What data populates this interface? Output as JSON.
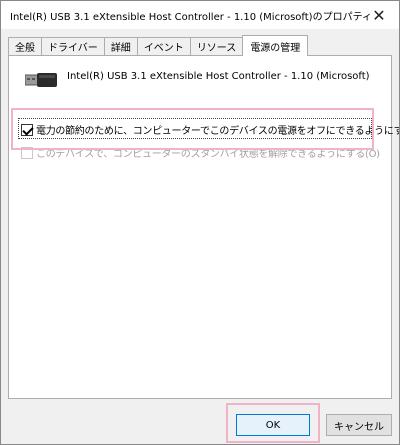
{
  "window": {
    "title": "Intel(R) USB 3.1 eXtensible Host Controller - 1.10 (Microsoft)のプロパティ",
    "close_glyph": "✕"
  },
  "tabs": [
    {
      "label": "全般",
      "active": false
    },
    {
      "label": "ドライバー",
      "active": false
    },
    {
      "label": "詳細",
      "active": false
    },
    {
      "label": "イベント",
      "active": false
    },
    {
      "label": "リソース",
      "active": false
    },
    {
      "label": "電源の管理",
      "active": true
    }
  ],
  "device": {
    "icon": "usb-connector-icon",
    "name": "Intel(R) USB 3.1 eXtensible Host Controller - 1.10 (Microsoft)"
  },
  "options": [
    {
      "label": "電力の節約のために、コンピューターでこのデバイスの電源をオフにできるようにする(A)",
      "checked": true,
      "enabled": true
    },
    {
      "label": "このデバイスで、コンピューターのスタンバイ状態を解除できるようにする(O)",
      "checked": false,
      "enabled": false
    }
  ],
  "buttons": {
    "ok_label": "OK",
    "cancel_label": "キャンセル"
  },
  "highlight_color": "#f0b4c9",
  "accent_color": "#0078d7"
}
